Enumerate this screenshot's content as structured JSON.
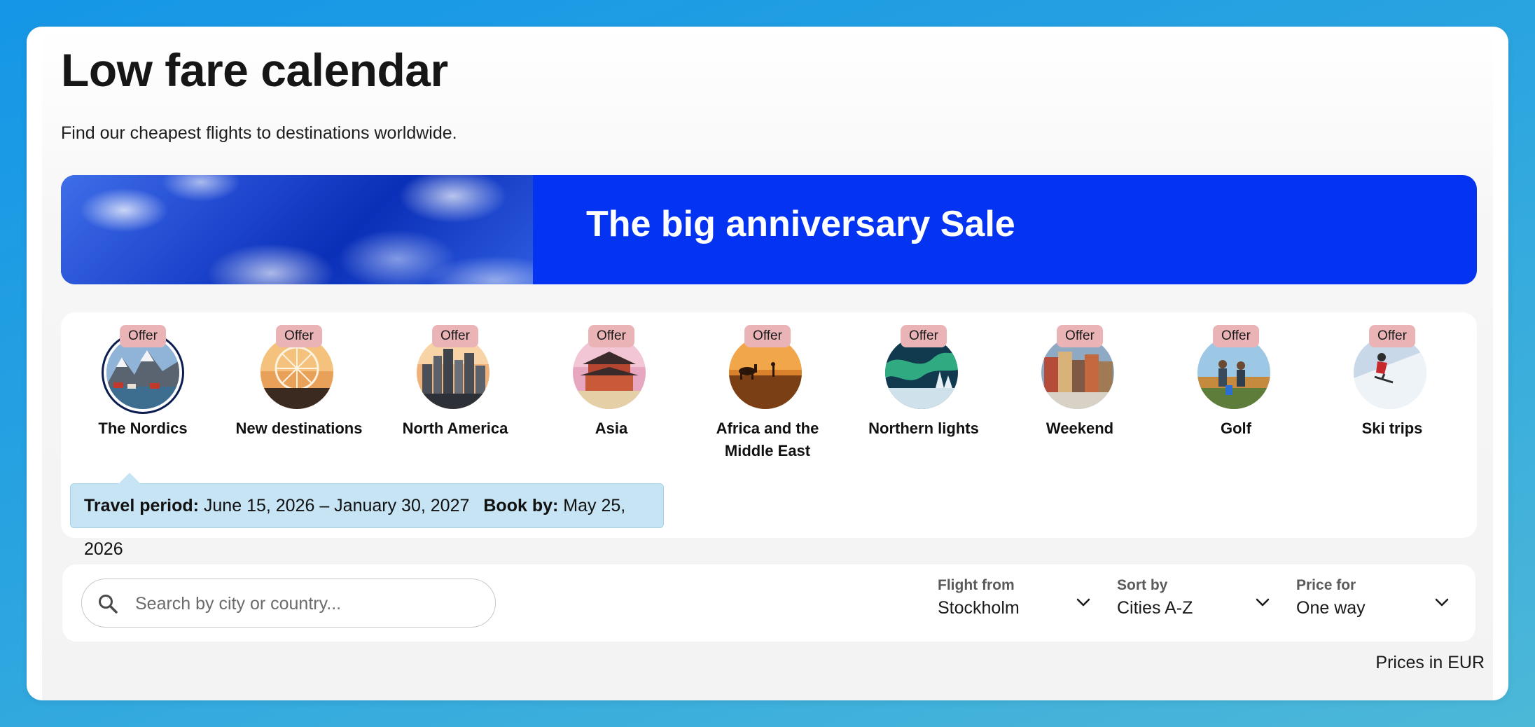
{
  "header": {
    "title": "Low fare calendar",
    "subtitle": "Find our cheapest flights to destinations worldwide."
  },
  "banner": {
    "title": "The big anniversary Sale",
    "colors": {
      "background": "#0533f2"
    }
  },
  "categories": {
    "offer_badge": "Offer",
    "items": [
      {
        "label": "The Nordics",
        "selected": true,
        "icon": "mountains-fjord-icon"
      },
      {
        "label": "New destinations",
        "selected": false,
        "icon": "ferris-wheel-icon"
      },
      {
        "label": "North America",
        "selected": false,
        "icon": "city-skyline-icon"
      },
      {
        "label": "Asia",
        "selected": false,
        "icon": "palace-icon"
      },
      {
        "label": "Africa and the Middle East",
        "selected": false,
        "icon": "desert-camel-icon"
      },
      {
        "label": "Northern lights",
        "selected": false,
        "icon": "aurora-icon"
      },
      {
        "label": "Weekend",
        "selected": false,
        "icon": "old-town-icon"
      },
      {
        "label": "Golf",
        "selected": false,
        "icon": "golfers-icon"
      },
      {
        "label": "Ski trips",
        "selected": false,
        "icon": "skier-icon"
      }
    ]
  },
  "travel_info": {
    "period_label": "Travel period:",
    "period_value": "June 15, 2026 – January 30, 2027",
    "book_label": "Book by:",
    "book_value": "May 25, 2026"
  },
  "filters": {
    "search_placeholder": "Search by city or country...",
    "flight_from": {
      "label": "Flight from",
      "value": "Stockholm"
    },
    "sort_by": {
      "label": "Sort by",
      "value": "Cities A-Z"
    },
    "price_for": {
      "label": "Price for",
      "value": "One way"
    }
  },
  "currency_note": "Prices in EUR",
  "colors": {
    "offer_badge": "#eab4b7",
    "tooltip_bg": "#c6e4f3",
    "selected_ring": "#0b1c4f"
  }
}
